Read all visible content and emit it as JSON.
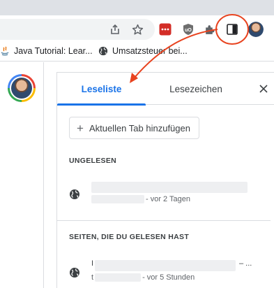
{
  "toolbar": {
    "icons": [
      "share-icon",
      "star-icon",
      "extension-lastpass-icon",
      "extension-ublock-icon",
      "puzzle-icon",
      "side-panel-icon",
      "profile-avatar"
    ]
  },
  "bookmarks": [
    {
      "label": "Java Tutorial: Lear...",
      "icon": "java-icon"
    },
    {
      "label": "Umsatzsteuer bei...",
      "icon": "globe-icon"
    }
  ],
  "panel": {
    "tabs": [
      {
        "label": "Leseliste",
        "active": true
      },
      {
        "label": "Lesezeichen",
        "active": false
      }
    ],
    "close_icon": "close-icon",
    "add_button": "Aktuellen Tab hinzufügen",
    "sections": [
      {
        "title": "UNGELESEN",
        "items": [
          {
            "time": "- vor 2 Tagen"
          }
        ]
      },
      {
        "title": "SEITEN, DIE DU GELESEN HAST",
        "items": [
          {
            "title_lead": "I",
            "title_suffix": "– ...",
            "url_lead": "t",
            "time": "- vor 5 Stunden"
          }
        ]
      }
    ]
  },
  "colors": {
    "accent": "#1a73e8",
    "annotation": "#e8431f",
    "divider": "#dadce0"
  }
}
